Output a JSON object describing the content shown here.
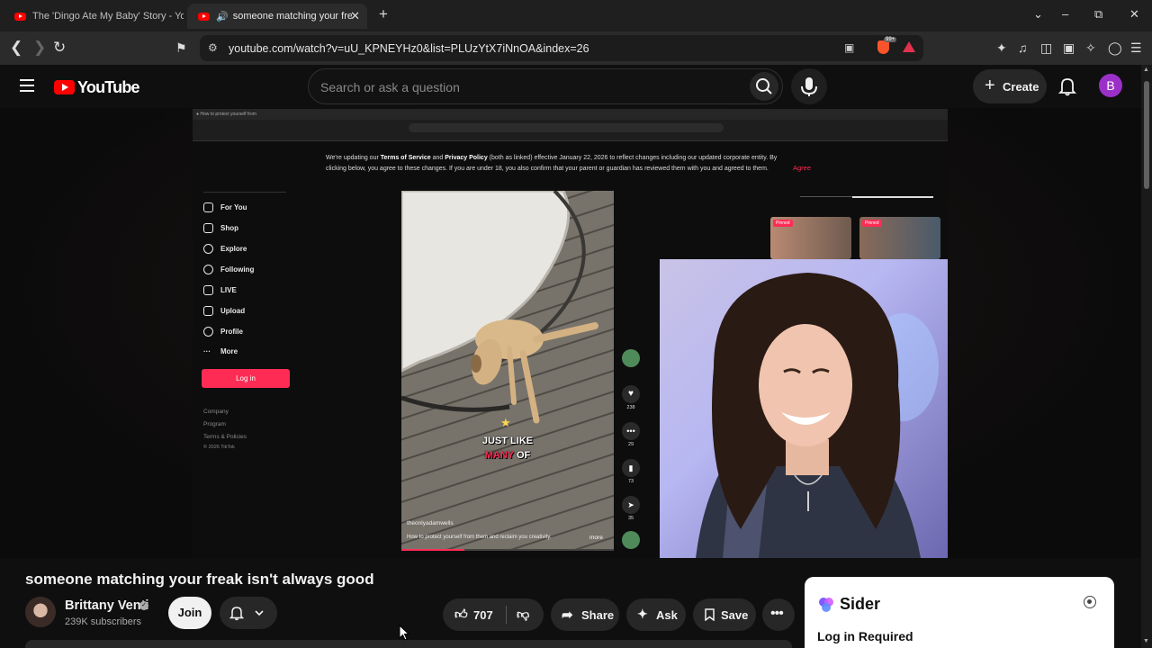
{
  "browser": {
    "tabs": [
      {
        "title": "The 'Dingo Ate My Baby' Story - You",
        "active": false
      },
      {
        "title": "someone matching your freak",
        "active": true,
        "audio": true
      }
    ],
    "url": "youtube.com/watch?v=uU_KPNEYHz0&list=PLUzYtX7iNnOA&index=26",
    "extension_badge": "99+"
  },
  "youtube": {
    "logo_text": "YouTube",
    "search_placeholder": "Search or ask a question",
    "create_label": "Create",
    "avatar_letter": "B"
  },
  "video_frame": {
    "notice_parts": {
      "pre": "We're updating our ",
      "tos": "Terms of Service",
      "mid": " and ",
      "pp": "Privacy Policy",
      "post": " (both as linked) effective January 22, 2026 to reflect changes including our updated corporate entity. By clicking below, you agree to these changes. If you are under 18, you also confirm that your parent or guardian has reviewed them with you and agreed to them."
    },
    "agree": "Agree",
    "nav": [
      "For You",
      "Shop",
      "Explore",
      "Following",
      "LIVE",
      "Upload",
      "Profile",
      "More"
    ],
    "login": "Log in",
    "footer": [
      "Company",
      "Program",
      "Terms & Policies",
      "© 2026 TikTok"
    ],
    "caption_line1": "JUST LIKE",
    "caption_line2_a": "MANY",
    "caption_line2_b": "OF",
    "author": "theonlyadamwells",
    "desc": "How to protect yourself from them and reclaim you creativity.",
    "more": "more",
    "counts": [
      "238",
      "29",
      "73",
      "35"
    ],
    "pinned": [
      "Pinned",
      "Pinned"
    ]
  },
  "video": {
    "title": "someone matching your freak isn't always good",
    "channel": "Brittany Venti",
    "subscribers": "239K subscribers",
    "join": "Join",
    "likes": "707",
    "share": "Share",
    "ask": "Ask",
    "save": "Save"
  },
  "sider": {
    "name": "Sider",
    "login_required": "Log in Required"
  }
}
